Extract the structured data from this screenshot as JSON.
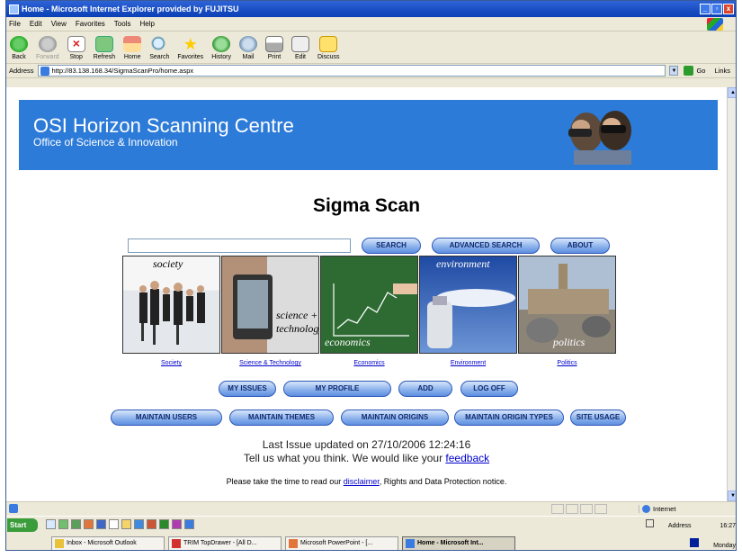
{
  "window": {
    "title": "Home - Microsoft Internet Explorer provided by FUJITSU"
  },
  "menu": [
    "File",
    "Edit",
    "View",
    "Favorites",
    "Tools",
    "Help"
  ],
  "toolbar": {
    "back": "Back",
    "forward": "Forward",
    "stop": "Stop",
    "refresh": "Refresh",
    "home": "Home",
    "search": "Search",
    "favorites": "Favorites",
    "history": "History",
    "mail": "Mail",
    "print": "Print",
    "edit": "Edit",
    "discuss": "Discuss"
  },
  "address": {
    "label": "Address",
    "url": "http://83.138.168.34/SigmaScanPro/home.aspx",
    "go": "Go",
    "links": "Links"
  },
  "banner": {
    "title": "OSI Horizon Scanning Centre",
    "subtitle": "Office of Science & Innovation"
  },
  "page": {
    "heading": "Sigma Scan",
    "search_value": "",
    "buttons": {
      "search": "SEARCH",
      "advanced": "ADVANCED SEARCH",
      "about": "ABOUT"
    },
    "tiles": [
      {
        "overlay": "society",
        "caption": "Society"
      },
      {
        "overlay": "science + technology",
        "caption": "Science & Technology"
      },
      {
        "overlay": "economics",
        "caption": "Economics"
      },
      {
        "overlay": "environment",
        "caption": "Environment"
      },
      {
        "overlay": "politics",
        "caption": "Politics"
      }
    ],
    "user_buttons": {
      "my_issues": "MY ISSUES",
      "my_profile": "MY PROFILE",
      "add": "ADD",
      "log_off": "LOG OFF"
    },
    "admin_buttons": {
      "maintain_users": "MAINTAIN USERS",
      "maintain_themes": "MAINTAIN THEMES",
      "maintain_origins": "MAINTAIN ORIGINS",
      "maintain_origin_types": "MAINTAIN ORIGIN TYPES",
      "site_usage": "SITE USAGE"
    },
    "last_updated": "Last Issue updated on 27/10/2006 12:24:16",
    "feedback_prefix": "Tell us what you think. We would like your ",
    "feedback_link": "feedback",
    "disclaimer_prefix": "Please take the time to read our ",
    "disclaimer_link": "disclaimer",
    "disclaimer_suffix": ", Rights and Data Protection notice."
  },
  "status": {
    "zone": "Internet"
  },
  "taskbar": {
    "start": "Start",
    "tray_address": "Address",
    "time": "16:27",
    "day": "Monday",
    "tasks": [
      {
        "label": "Inbox - Microsoft Outlook"
      },
      {
        "label": "TRIM TopDrawer - [All D..."
      },
      {
        "label": "Microsoft PowerPoint - [..."
      },
      {
        "label": "Home - Microsoft Int..."
      }
    ]
  }
}
